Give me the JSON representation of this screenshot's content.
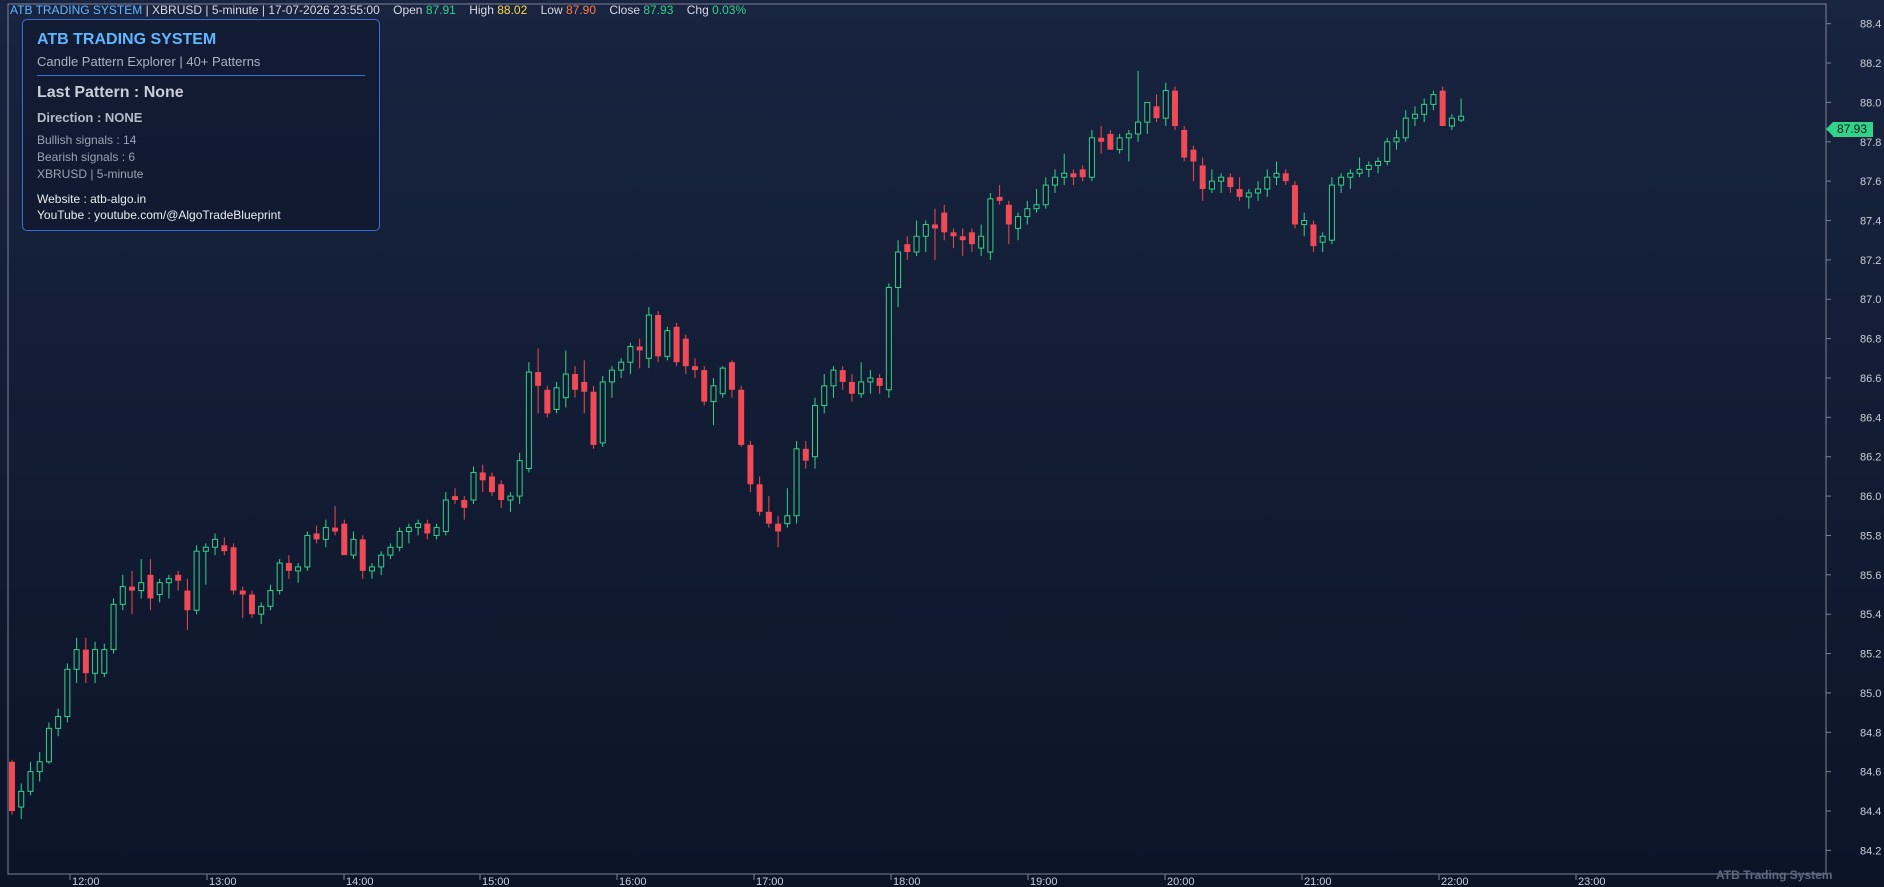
{
  "header": {
    "system": "ATB TRADING SYSTEM",
    "symbol": "XBRUSD",
    "timeframe": "5-minute",
    "datetime": "17-07-2026 23:55:00",
    "open_label": "Open",
    "open": "87.91",
    "high_label": "High",
    "high": "88.02",
    "low_label": "Low",
    "low": "87.90",
    "close_label": "Close",
    "close": "87.93",
    "chg_label": "Chg",
    "chg": "0.03%"
  },
  "infobox": {
    "title": "ATB TRADING SYSTEM",
    "subtitle": "Candle Pattern Explorer  |  40+ Patterns",
    "last_pattern": "Last Pattern : None",
    "direction": "Direction : NONE",
    "bullish": "Bullish signals : 14",
    "bearish": "Bearish signals : 6",
    "market": "XBRUSD   |   5-minute",
    "website": "Website : atb-algo.in",
    "youtube": "YouTube : youtube.com/@AlgoTradeBlueprint"
  },
  "last_price_label": "87.93",
  "watermark": "ATB Trading System",
  "colors": {
    "bull": "#31d38a",
    "bear": "#ef4a55",
    "axis": "#c9ced8",
    "panel_border": "#3d6fd0"
  },
  "chart_data": {
    "type": "candlestick",
    "x_labels": [
      "12:00",
      "13:00",
      "14:00",
      "15:00",
      "16:00",
      "17:00",
      "18:00",
      "19:00",
      "20:00",
      "21:00",
      "22:00",
      "23:00"
    ],
    "y_ticks": [
      "84.2",
      "84.4",
      "84.6",
      "84.8",
      "85.0",
      "85.2",
      "85.4",
      "85.6",
      "85.8",
      "86.0",
      "86.2",
      "86.4",
      "86.6",
      "86.8",
      "87.0",
      "87.2",
      "87.4",
      "87.6",
      "87.8",
      "88.0",
      "88.2",
      "88.4"
    ],
    "ylim": [
      84.08,
      88.5
    ],
    "grid": false,
    "candles": [
      {
        "o": 84.65,
        "h": 84.66,
        "l": 84.38,
        "c": 84.4
      },
      {
        "o": 84.42,
        "h": 84.54,
        "l": 84.36,
        "c": 84.5
      },
      {
        "o": 84.5,
        "h": 84.65,
        "l": 84.48,
        "c": 84.6
      },
      {
        "o": 84.6,
        "h": 84.7,
        "l": 84.55,
        "c": 84.65
      },
      {
        "o": 84.65,
        "h": 84.85,
        "l": 84.64,
        "c": 84.82
      },
      {
        "o": 84.82,
        "h": 84.92,
        "l": 84.78,
        "c": 84.88
      },
      {
        "o": 84.88,
        "h": 85.15,
        "l": 84.85,
        "c": 85.12
      },
      {
        "o": 85.12,
        "h": 85.28,
        "l": 85.05,
        "c": 85.22
      },
      {
        "o": 85.22,
        "h": 85.28,
        "l": 85.05,
        "c": 85.1
      },
      {
        "o": 85.1,
        "h": 85.26,
        "l": 85.05,
        "c": 85.22
      },
      {
        "o": 85.1,
        "h": 85.25,
        "l": 85.08,
        "c": 85.22
      },
      {
        "o": 85.22,
        "h": 85.48,
        "l": 85.2,
        "c": 85.45
      },
      {
        "o": 85.45,
        "h": 85.6,
        "l": 85.42,
        "c": 85.54
      },
      {
        "o": 85.54,
        "h": 85.62,
        "l": 85.4,
        "c": 85.52
      },
      {
        "o": 85.52,
        "h": 85.68,
        "l": 85.48,
        "c": 85.56
      },
      {
        "o": 85.6,
        "h": 85.68,
        "l": 85.42,
        "c": 85.48
      },
      {
        "o": 85.5,
        "h": 85.58,
        "l": 85.46,
        "c": 85.56
      },
      {
        "o": 85.56,
        "h": 85.6,
        "l": 85.48,
        "c": 85.58
      },
      {
        "o": 85.6,
        "h": 85.62,
        "l": 85.52,
        "c": 85.57
      },
      {
        "o": 85.52,
        "h": 85.58,
        "l": 85.32,
        "c": 85.42
      },
      {
        "o": 85.42,
        "h": 85.75,
        "l": 85.4,
        "c": 85.72
      },
      {
        "o": 85.72,
        "h": 85.76,
        "l": 85.55,
        "c": 85.74
      },
      {
        "o": 85.74,
        "h": 85.81,
        "l": 85.7,
        "c": 85.78
      },
      {
        "o": 85.75,
        "h": 85.79,
        "l": 85.7,
        "c": 85.72
      },
      {
        "o": 85.74,
        "h": 85.76,
        "l": 85.5,
        "c": 85.52
      },
      {
        "o": 85.52,
        "h": 85.54,
        "l": 85.38,
        "c": 85.5
      },
      {
        "o": 85.5,
        "h": 85.52,
        "l": 85.38,
        "c": 85.4
      },
      {
        "o": 85.4,
        "h": 85.46,
        "l": 85.35,
        "c": 85.44
      },
      {
        "o": 85.44,
        "h": 85.55,
        "l": 85.42,
        "c": 85.52
      },
      {
        "o": 85.52,
        "h": 85.68,
        "l": 85.5,
        "c": 85.66
      },
      {
        "o": 85.66,
        "h": 85.7,
        "l": 85.58,
        "c": 85.62
      },
      {
        "o": 85.62,
        "h": 85.66,
        "l": 85.56,
        "c": 85.64
      },
      {
        "o": 85.64,
        "h": 85.82,
        "l": 85.62,
        "c": 85.8
      },
      {
        "o": 85.81,
        "h": 85.85,
        "l": 85.76,
        "c": 85.78
      },
      {
        "o": 85.78,
        "h": 85.88,
        "l": 85.74,
        "c": 85.84
      },
      {
        "o": 85.84,
        "h": 85.95,
        "l": 85.8,
        "c": 85.82
      },
      {
        "o": 85.86,
        "h": 85.88,
        "l": 85.72,
        "c": 85.7
      },
      {
        "o": 85.7,
        "h": 85.82,
        "l": 85.68,
        "c": 85.78
      },
      {
        "o": 85.78,
        "h": 85.8,
        "l": 85.58,
        "c": 85.62
      },
      {
        "o": 85.62,
        "h": 85.66,
        "l": 85.58,
        "c": 85.64
      },
      {
        "o": 85.64,
        "h": 85.72,
        "l": 85.6,
        "c": 85.7
      },
      {
        "o": 85.7,
        "h": 85.76,
        "l": 85.68,
        "c": 85.74
      },
      {
        "o": 85.74,
        "h": 85.84,
        "l": 85.72,
        "c": 85.82
      },
      {
        "o": 85.82,
        "h": 85.86,
        "l": 85.76,
        "c": 85.84
      },
      {
        "o": 85.84,
        "h": 85.88,
        "l": 85.8,
        "c": 85.86
      },
      {
        "o": 85.86,
        "h": 85.88,
        "l": 85.78,
        "c": 85.81
      },
      {
        "o": 85.8,
        "h": 85.86,
        "l": 85.78,
        "c": 85.84
      },
      {
        "o": 85.82,
        "h": 86.02,
        "l": 85.8,
        "c": 85.98
      },
      {
        "o": 86.0,
        "h": 86.04,
        "l": 85.96,
        "c": 85.98
      },
      {
        "o": 85.98,
        "h": 86.0,
        "l": 85.88,
        "c": 85.94
      },
      {
        "o": 85.98,
        "h": 86.15,
        "l": 85.96,
        "c": 86.12
      },
      {
        "o": 86.12,
        "h": 86.16,
        "l": 86.02,
        "c": 86.08
      },
      {
        "o": 86.1,
        "h": 86.12,
        "l": 86.0,
        "c": 86.02
      },
      {
        "o": 86.06,
        "h": 86.08,
        "l": 85.94,
        "c": 85.98
      },
      {
        "o": 85.98,
        "h": 86.02,
        "l": 85.92,
        "c": 86.0
      },
      {
        "o": 86.0,
        "h": 86.22,
        "l": 85.96,
        "c": 86.18
      },
      {
        "o": 86.14,
        "h": 86.68,
        "l": 86.12,
        "c": 86.63
      },
      {
        "o": 86.63,
        "h": 86.75,
        "l": 86.42,
        "c": 86.56
      },
      {
        "o": 86.54,
        "h": 86.56,
        "l": 86.4,
        "c": 86.42
      },
      {
        "o": 86.44,
        "h": 86.58,
        "l": 86.42,
        "c": 86.55
      },
      {
        "o": 86.5,
        "h": 86.74,
        "l": 86.45,
        "c": 86.62
      },
      {
        "o": 86.62,
        "h": 86.66,
        "l": 86.5,
        "c": 86.54
      },
      {
        "o": 86.58,
        "h": 86.69,
        "l": 86.42,
        "c": 86.53
      },
      {
        "o": 86.53,
        "h": 86.56,
        "l": 86.24,
        "c": 86.26
      },
      {
        "o": 86.27,
        "h": 86.61,
        "l": 86.25,
        "c": 86.58
      },
      {
        "o": 86.58,
        "h": 86.66,
        "l": 86.5,
        "c": 86.64
      },
      {
        "o": 86.64,
        "h": 86.7,
        "l": 86.6,
        "c": 86.68
      },
      {
        "o": 86.68,
        "h": 86.78,
        "l": 86.62,
        "c": 86.76
      },
      {
        "o": 86.76,
        "h": 86.8,
        "l": 86.65,
        "c": 86.74
      },
      {
        "o": 86.7,
        "h": 86.96,
        "l": 86.65,
        "c": 86.92
      },
      {
        "o": 86.92,
        "h": 86.94,
        "l": 86.68,
        "c": 86.71
      },
      {
        "o": 86.71,
        "h": 86.86,
        "l": 86.69,
        "c": 86.84
      },
      {
        "o": 86.86,
        "h": 86.88,
        "l": 86.66,
        "c": 86.68
      },
      {
        "o": 86.8,
        "h": 86.82,
        "l": 86.62,
        "c": 86.66
      },
      {
        "o": 86.66,
        "h": 86.7,
        "l": 86.6,
        "c": 86.64
      },
      {
        "o": 86.64,
        "h": 86.66,
        "l": 86.46,
        "c": 86.48
      },
      {
        "o": 86.48,
        "h": 86.6,
        "l": 86.36,
        "c": 86.56
      },
      {
        "o": 86.52,
        "h": 86.66,
        "l": 86.5,
        "c": 86.65
      },
      {
        "o": 86.68,
        "h": 86.69,
        "l": 86.5,
        "c": 86.54
      },
      {
        "o": 86.54,
        "h": 86.56,
        "l": 86.25,
        "c": 86.26
      },
      {
        "o": 86.26,
        "h": 86.28,
        "l": 86.02,
        "c": 86.06
      },
      {
        "o": 86.06,
        "h": 86.1,
        "l": 85.9,
        "c": 85.92
      },
      {
        "o": 85.92,
        "h": 86.0,
        "l": 85.84,
        "c": 85.86
      },
      {
        "o": 85.86,
        "h": 85.9,
        "l": 85.74,
        "c": 85.82
      },
      {
        "o": 85.86,
        "h": 86.04,
        "l": 85.84,
        "c": 85.9
      },
      {
        "o": 85.9,
        "h": 86.28,
        "l": 85.86,
        "c": 86.24
      },
      {
        "o": 86.24,
        "h": 86.28,
        "l": 86.14,
        "c": 86.18
      },
      {
        "o": 86.2,
        "h": 86.5,
        "l": 86.14,
        "c": 86.46
      },
      {
        "o": 86.46,
        "h": 86.62,
        "l": 86.42,
        "c": 86.56
      },
      {
        "o": 86.56,
        "h": 86.66,
        "l": 86.5,
        "c": 86.64
      },
      {
        "o": 86.64,
        "h": 86.66,
        "l": 86.54,
        "c": 86.58
      },
      {
        "o": 86.58,
        "h": 86.62,
        "l": 86.48,
        "c": 86.52
      },
      {
        "o": 86.52,
        "h": 86.68,
        "l": 86.5,
        "c": 86.58
      },
      {
        "o": 86.58,
        "h": 86.64,
        "l": 86.52,
        "c": 86.6
      },
      {
        "o": 86.6,
        "h": 86.62,
        "l": 86.52,
        "c": 86.56
      },
      {
        "o": 86.54,
        "h": 87.08,
        "l": 86.5,
        "c": 87.06
      },
      {
        "o": 87.06,
        "h": 87.3,
        "l": 86.96,
        "c": 87.24
      },
      {
        "o": 87.28,
        "h": 87.32,
        "l": 87.2,
        "c": 87.24
      },
      {
        "o": 87.24,
        "h": 87.4,
        "l": 87.22,
        "c": 87.32
      },
      {
        "o": 87.32,
        "h": 87.4,
        "l": 87.24,
        "c": 87.38
      },
      {
        "o": 87.38,
        "h": 87.46,
        "l": 87.2,
        "c": 87.36
      },
      {
        "o": 87.44,
        "h": 87.48,
        "l": 87.3,
        "c": 87.34
      },
      {
        "o": 87.34,
        "h": 87.36,
        "l": 87.26,
        "c": 87.32
      },
      {
        "o": 87.32,
        "h": 87.36,
        "l": 87.22,
        "c": 87.3
      },
      {
        "o": 87.34,
        "h": 87.36,
        "l": 87.24,
        "c": 87.28
      },
      {
        "o": 87.26,
        "h": 87.38,
        "l": 87.22,
        "c": 87.32
      },
      {
        "o": 87.24,
        "h": 87.54,
        "l": 87.2,
        "c": 87.51
      },
      {
        "o": 87.52,
        "h": 87.58,
        "l": 87.48,
        "c": 87.5
      },
      {
        "o": 87.48,
        "h": 87.5,
        "l": 87.28,
        "c": 87.38
      },
      {
        "o": 87.36,
        "h": 87.44,
        "l": 87.3,
        "c": 87.42
      },
      {
        "o": 87.42,
        "h": 87.5,
        "l": 87.38,
        "c": 87.46
      },
      {
        "o": 87.46,
        "h": 87.56,
        "l": 87.44,
        "c": 87.48
      },
      {
        "o": 87.48,
        "h": 87.62,
        "l": 87.46,
        "c": 87.58
      },
      {
        "o": 87.58,
        "h": 87.66,
        "l": 87.54,
        "c": 87.62
      },
      {
        "o": 87.62,
        "h": 87.74,
        "l": 87.58,
        "c": 87.64
      },
      {
        "o": 87.64,
        "h": 87.66,
        "l": 87.58,
        "c": 87.62
      },
      {
        "o": 87.66,
        "h": 87.68,
        "l": 87.6,
        "c": 87.62
      },
      {
        "o": 87.62,
        "h": 87.86,
        "l": 87.6,
        "c": 87.82
      },
      {
        "o": 87.82,
        "h": 87.88,
        "l": 87.74,
        "c": 87.8
      },
      {
        "o": 87.84,
        "h": 87.86,
        "l": 87.76,
        "c": 87.76
      },
      {
        "o": 87.76,
        "h": 87.84,
        "l": 87.74,
        "c": 87.82
      },
      {
        "o": 87.82,
        "h": 87.86,
        "l": 87.7,
        "c": 87.84
      },
      {
        "o": 87.84,
        "h": 88.16,
        "l": 87.8,
        "c": 87.9
      },
      {
        "o": 87.9,
        "h": 88.0,
        "l": 87.84,
        "c": 88.0
      },
      {
        "o": 87.98,
        "h": 88.04,
        "l": 87.9,
        "c": 87.92
      },
      {
        "o": 87.92,
        "h": 88.1,
        "l": 87.88,
        "c": 88.06
      },
      {
        "o": 88.06,
        "h": 88.08,
        "l": 87.86,
        "c": 87.88
      },
      {
        "o": 87.86,
        "h": 87.88,
        "l": 87.7,
        "c": 87.72
      },
      {
        "o": 87.76,
        "h": 87.78,
        "l": 87.6,
        "c": 87.7
      },
      {
        "o": 87.68,
        "h": 87.72,
        "l": 87.5,
        "c": 87.56
      },
      {
        "o": 87.56,
        "h": 87.66,
        "l": 87.54,
        "c": 87.6
      },
      {
        "o": 87.6,
        "h": 87.64,
        "l": 87.54,
        "c": 87.62
      },
      {
        "o": 87.62,
        "h": 87.64,
        "l": 87.54,
        "c": 87.57
      },
      {
        "o": 87.56,
        "h": 87.62,
        "l": 87.5,
        "c": 87.52
      },
      {
        "o": 87.52,
        "h": 87.56,
        "l": 87.46,
        "c": 87.54
      },
      {
        "o": 87.54,
        "h": 87.6,
        "l": 87.5,
        "c": 87.56
      },
      {
        "o": 87.56,
        "h": 87.66,
        "l": 87.52,
        "c": 87.62
      },
      {
        "o": 87.62,
        "h": 87.7,
        "l": 87.58,
        "c": 87.64
      },
      {
        "o": 87.64,
        "h": 87.66,
        "l": 87.58,
        "c": 87.6
      },
      {
        "o": 87.58,
        "h": 87.6,
        "l": 87.36,
        "c": 87.38
      },
      {
        "o": 87.38,
        "h": 87.44,
        "l": 87.32,
        "c": 87.4
      },
      {
        "o": 87.38,
        "h": 87.4,
        "l": 87.24,
        "c": 87.27
      },
      {
        "o": 87.29,
        "h": 87.34,
        "l": 87.24,
        "c": 87.32
      },
      {
        "o": 87.3,
        "h": 87.62,
        "l": 87.28,
        "c": 87.58
      },
      {
        "o": 87.58,
        "h": 87.64,
        "l": 87.54,
        "c": 87.62
      },
      {
        "o": 87.62,
        "h": 87.66,
        "l": 87.56,
        "c": 87.64
      },
      {
        "o": 87.64,
        "h": 87.72,
        "l": 87.62,
        "c": 87.66
      },
      {
        "o": 87.66,
        "h": 87.7,
        "l": 87.62,
        "c": 87.68
      },
      {
        "o": 87.68,
        "h": 87.72,
        "l": 87.64,
        "c": 87.7
      },
      {
        "o": 87.7,
        "h": 87.82,
        "l": 87.68,
        "c": 87.8
      },
      {
        "o": 87.8,
        "h": 87.86,
        "l": 87.76,
        "c": 87.82
      },
      {
        "o": 87.82,
        "h": 87.96,
        "l": 87.8,
        "c": 87.92
      },
      {
        "o": 87.92,
        "h": 87.98,
        "l": 87.88,
        "c": 87.94
      },
      {
        "o": 87.94,
        "h": 88.02,
        "l": 87.9,
        "c": 87.99
      },
      {
        "o": 87.99,
        "h": 88.06,
        "l": 87.96,
        "c": 88.04
      },
      {
        "o": 88.06,
        "h": 88.08,
        "l": 87.88,
        "c": 87.88
      },
      {
        "o": 87.88,
        "h": 87.94,
        "l": 87.86,
        "c": 87.92
      },
      {
        "o": 87.91,
        "h": 88.02,
        "l": 87.9,
        "c": 87.93
      }
    ]
  }
}
